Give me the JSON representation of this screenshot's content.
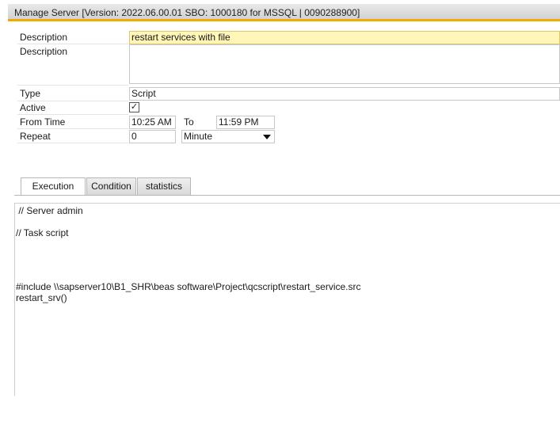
{
  "window": {
    "title": "Manage Server  [Version: 2022.06.00.01 SBO: 1000180 for MSSQL | 0090288900]"
  },
  "form": {
    "description_label": "Description",
    "description_value": "restart services with file",
    "description2_label": "Description",
    "description2_value": "",
    "type_label": "Type",
    "type_value": "Script",
    "active_label": "Active",
    "active_checked": "✓",
    "from_time_label": "From Time",
    "from_time_value": "10:25 AM",
    "to_label": "To",
    "to_value": "11:59 PM",
    "repeat_label": "Repeat",
    "repeat_value": "0",
    "repeat_unit": "Minute"
  },
  "tabs": [
    {
      "label": "Execution",
      "active": true
    },
    {
      "label": "Condition",
      "active": false
    },
    {
      "label": "statistics",
      "active": false
    }
  ],
  "editor": {
    "lines": [
      " // Server admin",
      "// Task script",
      "#include \\\\sapserver10\\B1_SHR\\beas software\\Project\\qcscript\\restart_service.src",
      "restart_srv()"
    ]
  },
  "colors": {
    "accent": "#f0ab00",
    "highlight_field": "#fff6b8"
  }
}
